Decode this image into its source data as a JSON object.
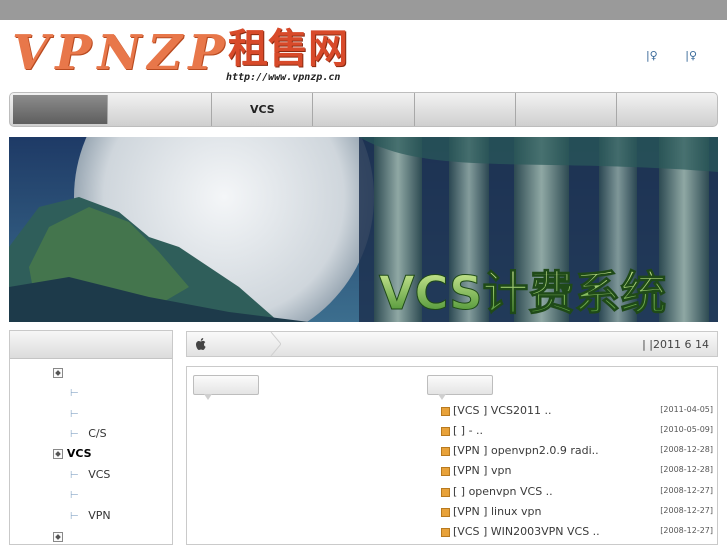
{
  "header": {
    "logo_text": "VPNZP",
    "logo_cn": "租售网",
    "logo_url": "http://www.vpnzp.cn",
    "top_links": [
      "|♀",
      "|♀"
    ]
  },
  "nav": {
    "items": [
      "",
      "",
      "VCS",
      "",
      "",
      "",
      "",
      ""
    ]
  },
  "banner": {
    "caption": "VCS计费系统"
  },
  "sidebar": {
    "tree": [
      {
        "text": "",
        "kind": "box"
      },
      {
        "text": "",
        "kind": "branch"
      },
      {
        "text": "",
        "kind": "branch"
      },
      {
        "text": "C/S",
        "kind": "branch"
      },
      {
        "text": "VCS",
        "kind": "box"
      },
      {
        "text": "VCS",
        "kind": "branch"
      },
      {
        "text": "",
        "kind": "branch"
      },
      {
        "text": "VPN",
        "kind": "branch"
      },
      {
        "text": "",
        "kind": "box"
      }
    ]
  },
  "breadcrumb": {
    "right_text": "|   |2011 6 14"
  },
  "news": {
    "items": [
      {
        "title": "[VCS ] VCS2011       ..",
        "date": "[2011-04-05]"
      },
      {
        "title": "[  ]      -   ..",
        "date": "[2010-05-09]"
      },
      {
        "title": "[VPN ] openvpn2.0.9  radi..",
        "date": "[2008-12-28]"
      },
      {
        "title": "[VPN ] vpn",
        "date": "[2008-12-28]"
      },
      {
        "title": "[  ] openvpn VCS     ..",
        "date": "[2008-12-27]"
      },
      {
        "title": "[VPN ] linux  vpn",
        "date": "[2008-12-27]"
      },
      {
        "title": "[VCS ] WIN2003VPN   VCS ..",
        "date": "[2008-12-27]"
      }
    ]
  },
  "colors": {
    "topbar": "#9a9a9a",
    "logo_orange": "#e8774a",
    "logo_red": "#d84a2a",
    "bullet": "#e8a23a"
  }
}
